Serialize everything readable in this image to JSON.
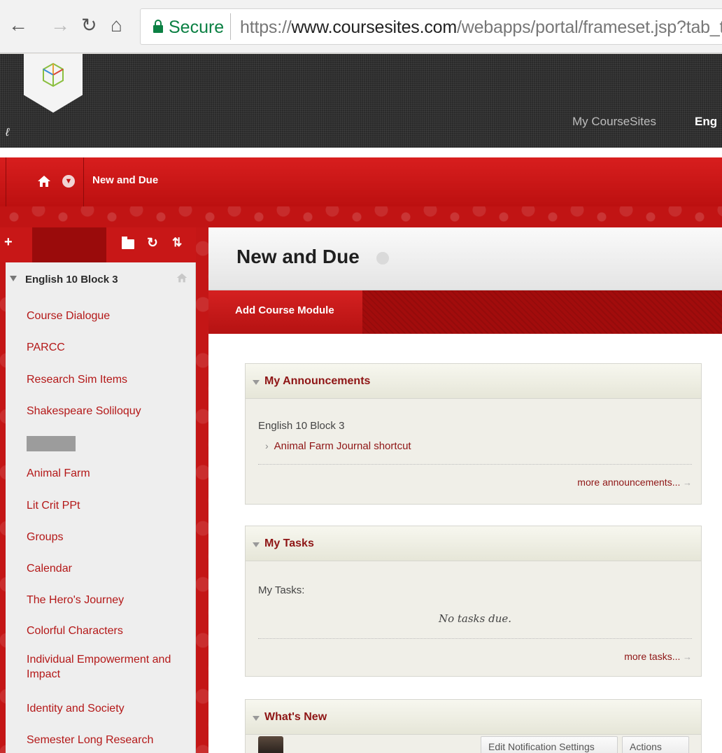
{
  "browser": {
    "secure_label": "Secure",
    "url_prefix": "https://",
    "url_domain": "www.coursesites.com",
    "url_path": "/webapps/portal/frameset.jsp?tab_tab_gr"
  },
  "site_header": {
    "nav_my_coursesites": "My CourseSites",
    "nav_eng": "Eng"
  },
  "course_bar": {
    "breadcrumb_title": "New and Due"
  },
  "menu": {
    "add_label": "+",
    "course_title": "English 10 Block 3",
    "items": [
      {
        "label": "Course Dialogue"
      },
      {
        "label": "PARCC"
      },
      {
        "label": "Research Sim Items"
      },
      {
        "label": "Shakespeare Soliloquy"
      },
      {
        "label": ""
      },
      {
        "label": "Animal Farm"
      },
      {
        "label": "Lit Crit PPt"
      },
      {
        "label": "Groups"
      },
      {
        "label": "Calendar"
      },
      {
        "label": "The Hero's Journey"
      },
      {
        "label": "Colorful Characters"
      },
      {
        "label": "Individual Empowerment and Impact"
      },
      {
        "label": "Identity and Society"
      },
      {
        "label": "Semester Long Research"
      }
    ]
  },
  "page": {
    "title": "New and Due",
    "add_module_label": "Add Course Module"
  },
  "announcements": {
    "title": "My Announcements",
    "course": "English 10 Block 3",
    "items": [
      "Animal Farm Journal shortcut"
    ],
    "more_label": "more announcements..."
  },
  "tasks": {
    "title": "My Tasks",
    "heading": "My Tasks:",
    "empty": "No tasks due.",
    "more_label": "more tasks..."
  },
  "whats_new": {
    "title": "What's New",
    "edit_settings_label": "Edit Notification Settings",
    "actions_label": "Actions"
  },
  "colors": {
    "brand_red": "#c41616",
    "link_red": "#8e1515",
    "secure_green": "#0b8043"
  },
  "icons": [
    "back-arrow-icon",
    "forward-arrow-icon",
    "reload-icon",
    "home-icon",
    "lock-icon",
    "logo-icon",
    "pin-icon",
    "chevron-down-icon",
    "folder-icon",
    "refresh-icon",
    "sort-icon"
  ]
}
